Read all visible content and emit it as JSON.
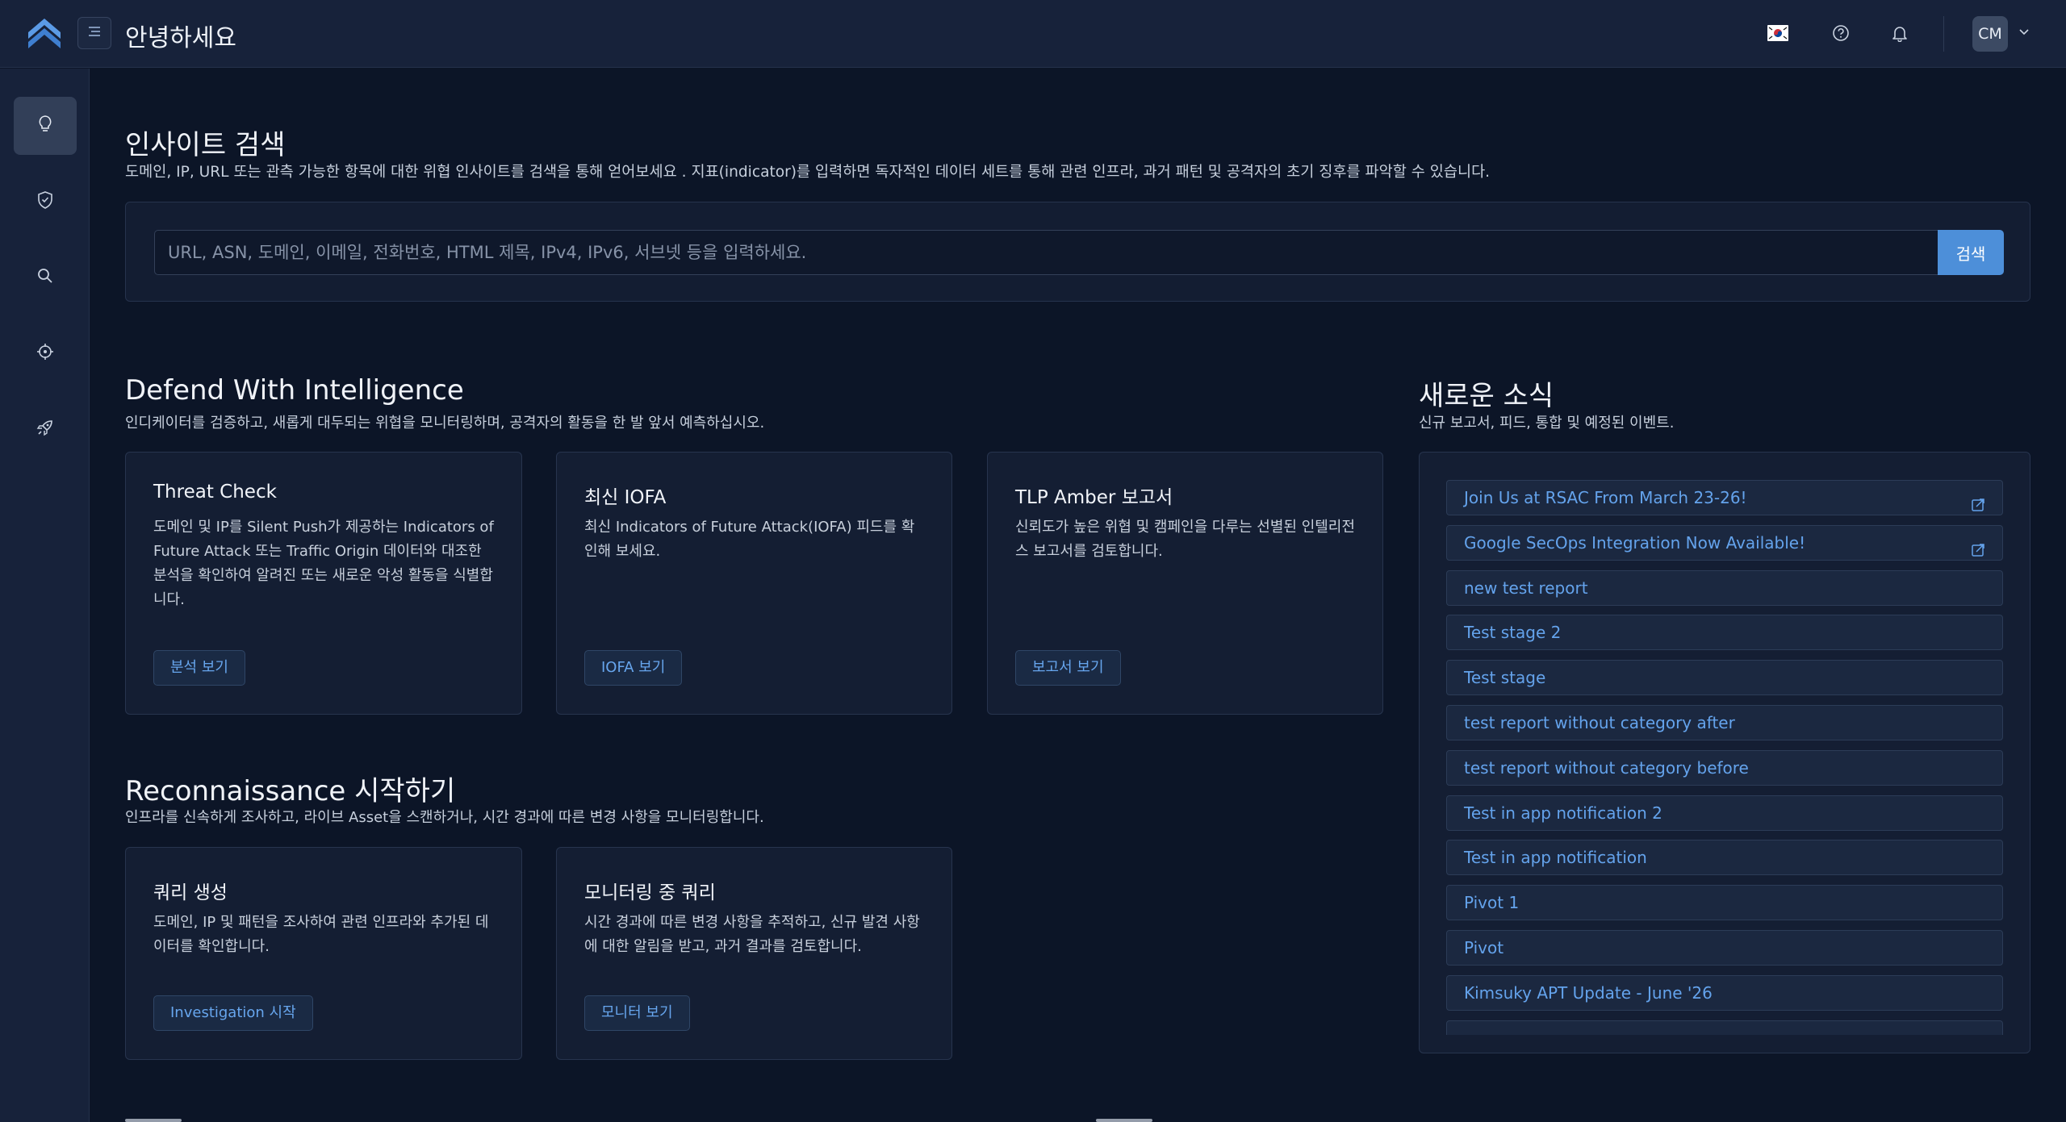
{
  "header": {
    "title": "안녕하세요",
    "avatar_initials": "CM",
    "icons": [
      "korea-flag-icon",
      "help-icon",
      "bell-icon",
      "chevron-down-icon"
    ]
  },
  "sidebar": {
    "items": [
      {
        "name": "insights",
        "icon": "lightbulb-icon",
        "active": true
      },
      {
        "name": "defend",
        "icon": "shield-check-icon",
        "active": false
      },
      {
        "name": "search",
        "icon": "search-icon",
        "active": false
      },
      {
        "name": "target",
        "icon": "crosshair-icon",
        "active": false
      },
      {
        "name": "integrations",
        "icon": "rocket-icon",
        "active": false
      }
    ]
  },
  "insight_search": {
    "title": "인사이트 검색",
    "subtitle": "도메인, IP, URL 또는 관측 가능한 항목에 대한 위협 인사이트를 검색을 통해 얻어보세요 . 지표(indicator)를 입력하면 독자적인 데이터 세트를 통해 관련 인프라, 과거 패턴 및 공격자의 초기 징후를 파악할 수 있습니다.",
    "placeholder": "URL, ASN, 도메인, 이메일, 전화번호, HTML 제목, IPv4, IPv6, 서브넷 등을 입력하세요.",
    "value": "",
    "button_label": "검색"
  },
  "defend": {
    "title": "Defend With Intelligence",
    "subtitle": "인디케이터를 검증하고, 새롭게 대두되는 위협을 모니터링하며, 공격자의 활동을 한 발 앞서 예측하십시오.",
    "cards": [
      {
        "title": "Threat Check",
        "description": "도메인 및 IP를 Silent Push가 제공하는 Indicators of Future Attack 또는 Traffic Origin 데이터와 대조한 분석을 확인하여 알려진 또는 새로운 악성 활동을 식별합니다.",
        "button": "분석 보기"
      },
      {
        "title": "최신 IOFA",
        "description": "최신 Indicators of Future Attack(IOFA) 피드를 확인해 보세요.",
        "button": "IOFA 보기"
      },
      {
        "title": "TLP Amber 보고서",
        "description": "신뢰도가 높은 위협 및 캠페인을 다루는 선별된 인텔리전스 보고서를 검토합니다.",
        "button": "보고서 보기"
      }
    ]
  },
  "recon": {
    "title": "Reconnaissance 시작하기",
    "subtitle": "인프라를 신속하게 조사하고, 라이브 Asset을 스캔하거나, 시간 경과에 따른 변경 사항을 모니터링합니다.",
    "cards": [
      {
        "title": "쿼리 생성",
        "description": "도메인, IP 및 패턴을 조사하여 관련 인프라와 추가된 데이터를 확인합니다.",
        "button": "Investigation 시작"
      },
      {
        "title": "모니터링 중 쿼리",
        "description": "시간 경과에 따른 변경 사항을 추적하고, 신규 발견 사항에 대한 알림을 받고, 과거 결과를 검토합니다.",
        "button": "모니터 보기"
      }
    ]
  },
  "news": {
    "title": "새로운 소식",
    "subtitle": "신규 보고서, 피드, 통합 및 예정된 이벤트.",
    "items": [
      {
        "label": "Join Us at RSAC From March 23-26!",
        "external": true
      },
      {
        "label": "Google SecOps Integration Now Available!",
        "external": true
      },
      {
        "label": "new test report",
        "external": false
      },
      {
        "label": "Test stage 2",
        "external": false
      },
      {
        "label": "Test stage",
        "external": false
      },
      {
        "label": "test report without category after",
        "external": false
      },
      {
        "label": "test report without category before",
        "external": false
      },
      {
        "label": "Test in app notification 2",
        "external": false
      },
      {
        "label": "Test in app notification",
        "external": false
      },
      {
        "label": "Pivot 1",
        "external": false
      },
      {
        "label": "Pivot",
        "external": false
      },
      {
        "label": "Kimsuky APT Update - June '26",
        "external": false
      },
      {
        "label": "",
        "external": false
      }
    ]
  },
  "colors": {
    "background": "#0c1527",
    "panel": "#141e33",
    "topbar": "#17223a",
    "accent": "#4d8fd9",
    "link": "#64a3ec"
  }
}
